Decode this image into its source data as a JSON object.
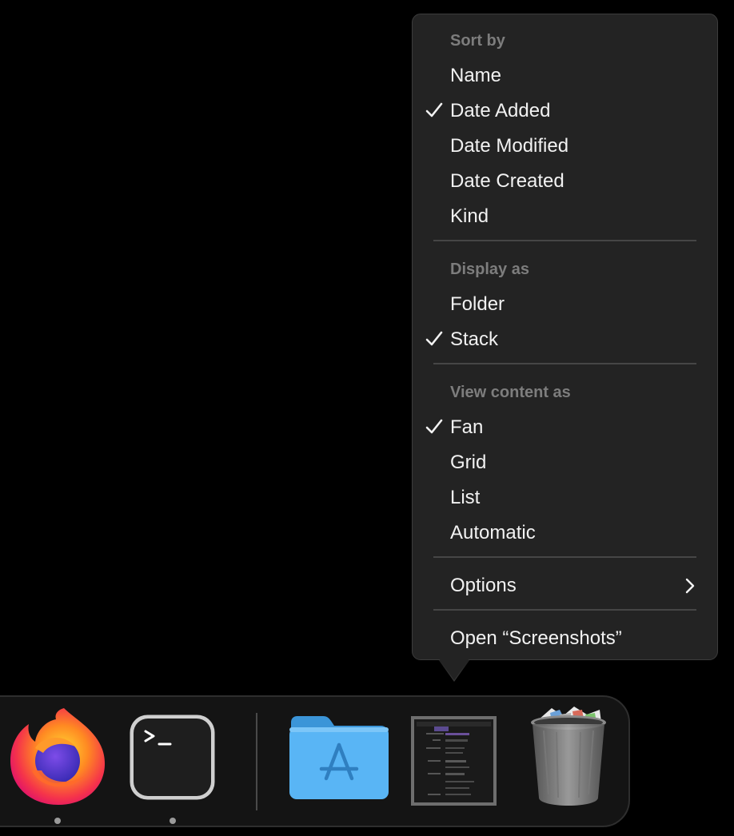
{
  "menu": {
    "sort_by": {
      "header": "Sort by",
      "items": [
        {
          "label": "Name",
          "checked": false
        },
        {
          "label": "Date Added",
          "checked": true
        },
        {
          "label": "Date Modified",
          "checked": false
        },
        {
          "label": "Date Created",
          "checked": false
        },
        {
          "label": "Kind",
          "checked": false
        }
      ]
    },
    "display_as": {
      "header": "Display as",
      "items": [
        {
          "label": "Folder",
          "checked": false
        },
        {
          "label": "Stack",
          "checked": true
        }
      ]
    },
    "view_content_as": {
      "header": "View content as",
      "items": [
        {
          "label": "Fan",
          "checked": true
        },
        {
          "label": "Grid",
          "checked": false
        },
        {
          "label": "List",
          "checked": false
        },
        {
          "label": "Automatic",
          "checked": false
        }
      ]
    },
    "options_label": "Options",
    "open_label": "Open “Screenshots”"
  },
  "dock": {
    "items": [
      {
        "name": "Firefox",
        "icon": "firefox-icon",
        "running": true
      },
      {
        "name": "Terminal",
        "icon": "terminal-icon",
        "running": true
      },
      {
        "name": "Applications",
        "icon": "applications-folder-icon",
        "running": false
      },
      {
        "name": "Screenshots",
        "icon": "screenshots-stack-icon",
        "running": false
      },
      {
        "name": "Trash",
        "icon": "trash-icon",
        "running": false
      }
    ]
  },
  "colors": {
    "menu_bg": "#232323",
    "menu_header": "#7d7d7d",
    "menu_text": "#f2f2f2",
    "folder_blue": "#4fb0f3"
  }
}
